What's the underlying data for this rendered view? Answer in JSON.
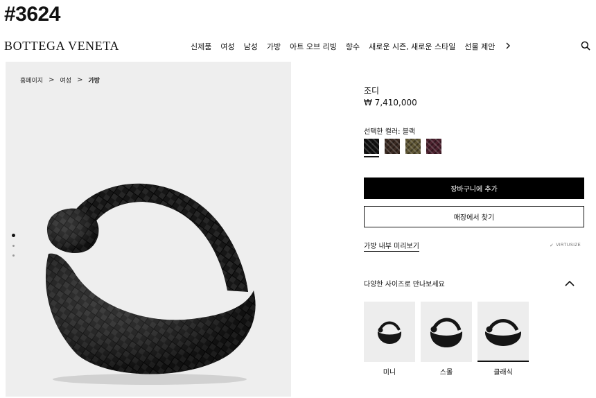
{
  "overlay": {
    "tag": "#3624"
  },
  "header": {
    "brand": "BOTTEGA VENETA",
    "nav": [
      "신제품",
      "여성",
      "남성",
      "가방",
      "아트 오브 리빙",
      "향수",
      "새로운 시즌, 새로운 스타일",
      "선물 제안"
    ],
    "more_icon": "chevron-right-icon",
    "search_icon": "search-icon"
  },
  "breadcrumb": {
    "items": [
      "홈페이지",
      "여성"
    ],
    "current": "가방",
    "separator": ">"
  },
  "gallery": {
    "image_count": 3,
    "active_index": 0
  },
  "product": {
    "name": "조디",
    "price": "₩ 7,410,000",
    "color_label": "선택한 컬러: 블랙",
    "swatches": [
      {
        "name": "블랙",
        "color": "#111111",
        "selected": true
      },
      {
        "name": "brown",
        "color": "#3a2a22",
        "selected": false
      },
      {
        "name": "olive",
        "color": "#5d5433",
        "selected": false
      },
      {
        "name": "burgundy",
        "color": "#4a1f2c",
        "selected": false
      }
    ],
    "add_to_cart": "장바구니에 추가",
    "find_in_store": "매장에서 찾기",
    "inside_preview": "가방 내부 미리보기",
    "virtusize": "VIRTUSIZE",
    "sizes_title": "다양한 사이즈로 만나보세요",
    "sizes": [
      {
        "label": "미니",
        "selected": false
      },
      {
        "label": "스몰",
        "selected": false
      },
      {
        "label": "클래식",
        "selected": true
      }
    ]
  },
  "colors": {
    "primary": "#000000",
    "gallery_bg": "#eeeeee",
    "text": "#111111"
  }
}
